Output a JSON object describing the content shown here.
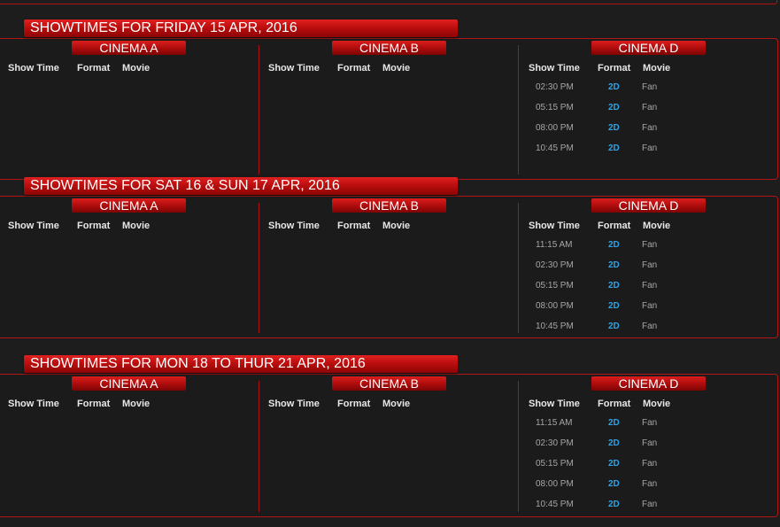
{
  "columns": {
    "show_time": "Show Time",
    "format": "Format",
    "movie": "Movie"
  },
  "colors": {
    "accent_red": "#c21010",
    "format_blue": "#2ea3e6",
    "background": "#1d1d1d"
  },
  "sections": [
    {
      "title": "SHOWTIMES FOR FRIDAY 15 APR, 2016",
      "cinemas": [
        {
          "name": "CINEMA A",
          "showings": []
        },
        {
          "name": "CINEMA B",
          "showings": []
        },
        {
          "name": "CINEMA D",
          "showings": [
            {
              "time": "02:30 PM",
              "format": "2D",
              "movie": "Fan"
            },
            {
              "time": "05:15 PM",
              "format": "2D",
              "movie": "Fan"
            },
            {
              "time": "08:00 PM",
              "format": "2D",
              "movie": "Fan"
            },
            {
              "time": "10:45 PM",
              "format": "2D",
              "movie": "Fan"
            }
          ]
        }
      ]
    },
    {
      "title": "SHOWTIMES FOR SAT 16 & SUN 17 APR, 2016",
      "cinemas": [
        {
          "name": "CINEMA A",
          "showings": []
        },
        {
          "name": "CINEMA B",
          "showings": []
        },
        {
          "name": "CINEMA D",
          "showings": [
            {
              "time": "11:15 AM",
              "format": "2D",
              "movie": "Fan"
            },
            {
              "time": "02:30 PM",
              "format": "2D",
              "movie": "Fan"
            },
            {
              "time": "05:15 PM",
              "format": "2D",
              "movie": "Fan"
            },
            {
              "time": "08:00 PM",
              "format": "2D",
              "movie": "Fan"
            },
            {
              "time": "10:45 PM",
              "format": "2D",
              "movie": "Fan"
            }
          ]
        }
      ]
    },
    {
      "title": "SHOWTIMES FOR MON 18 TO THUR 21 APR, 2016",
      "cinemas": [
        {
          "name": "CINEMA A",
          "showings": []
        },
        {
          "name": "CINEMA B",
          "showings": []
        },
        {
          "name": "CINEMA D",
          "showings": [
            {
              "time": "11:15 AM",
              "format": "2D",
              "movie": "Fan"
            },
            {
              "time": "02:30 PM",
              "format": "2D",
              "movie": "Fan"
            },
            {
              "time": "05:15 PM",
              "format": "2D",
              "movie": "Fan"
            },
            {
              "time": "08:00 PM",
              "format": "2D",
              "movie": "Fan"
            },
            {
              "time": "10:45 PM",
              "format": "2D",
              "movie": "Fan"
            }
          ]
        }
      ]
    }
  ]
}
